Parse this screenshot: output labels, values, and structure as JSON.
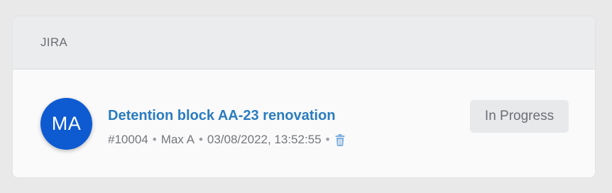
{
  "card": {
    "header_title": "JIRA"
  },
  "issue": {
    "avatar_initials": "MA",
    "title": "Detention block AA-23 renovation",
    "id": "#10004",
    "author": "Max A",
    "timestamp": "03/08/2022, 13:52:55",
    "separator": "•",
    "status": "In Progress",
    "delete_icon": "trash-icon"
  },
  "colors": {
    "avatar_bg": "#0e5bd1",
    "title_link": "#2b7cbf",
    "status_bg": "#e8e9eb",
    "trash_icon": "#7fb0de"
  }
}
